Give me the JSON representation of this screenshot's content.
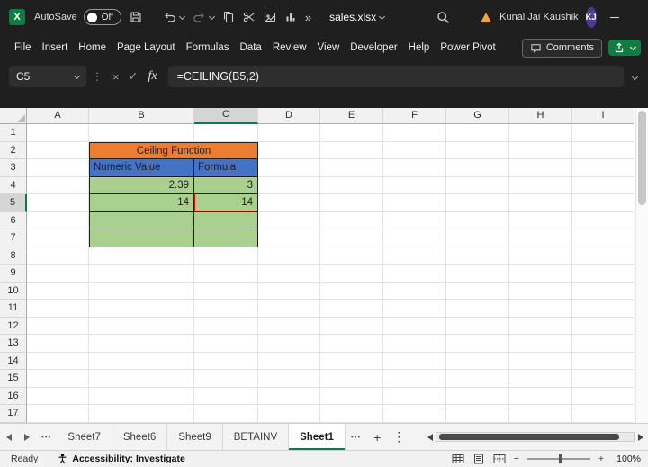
{
  "titlebar": {
    "autosave_label": "AutoSave",
    "autosave_state": "Off",
    "filename": "sales.xlsx",
    "user_name": "Kunal Jai Kaushik",
    "user_initials": "KJ"
  },
  "icons": {
    "excel_logo": "X",
    "more_chevrons": "»",
    "grip": "⋮",
    "cancel": "×",
    "check": "✓",
    "close": "×",
    "more_tabs": "•••",
    "plus": "+",
    "kebab": "⋮",
    "zoom_minus": "−",
    "zoom_plus": "+"
  },
  "menubar": {
    "items": [
      "File",
      "Insert",
      "Home",
      "Page Layout",
      "Formulas",
      "Data",
      "Review",
      "View",
      "Developer",
      "Help",
      "Power Pivot"
    ],
    "comments_label": "Comments"
  },
  "formula_bar": {
    "name_box": "C5",
    "fx_label": "fx",
    "formula": "=CEILING(B5,2)"
  },
  "grid": {
    "columns": [
      "A",
      "B",
      "C",
      "D",
      "E",
      "F",
      "G",
      "H",
      "I"
    ],
    "rows": [
      "1",
      "2",
      "3",
      "4",
      "5",
      "6",
      "7",
      "8",
      "9",
      "10",
      "11",
      "12",
      "13",
      "14",
      "15",
      "16",
      "17"
    ],
    "selected_cell": "C5",
    "selected_column": "C",
    "selected_row": "5",
    "cells": [
      {
        "ref": "B2",
        "colspan": 2,
        "text": "Ceiling Function",
        "kind": "title"
      },
      {
        "ref": "B3",
        "text": "Numeric Value",
        "kind": "header"
      },
      {
        "ref": "C3",
        "text": "Formula",
        "kind": "header"
      },
      {
        "ref": "B4",
        "text": "2.39",
        "kind": "value"
      },
      {
        "ref": "C4",
        "text": "3",
        "kind": "value"
      },
      {
        "ref": "B5",
        "text": "14",
        "kind": "value"
      },
      {
        "ref": "C5",
        "text": "14",
        "kind": "value",
        "highlight": "red-box"
      },
      {
        "ref": "B6",
        "text": "",
        "kind": "value"
      },
      {
        "ref": "C6",
        "text": "",
        "kind": "value"
      },
      {
        "ref": "B7",
        "text": "",
        "kind": "value"
      },
      {
        "ref": "C7",
        "text": "",
        "kind": "value"
      }
    ],
    "colors": {
      "title_bg": "#ED7D31",
      "header_bg": "#4472C4",
      "value_bg": "#A9D08E",
      "highlight_border": "#FF0000",
      "selection_green": "#107C41"
    }
  },
  "sheet_tabs": {
    "tabs": [
      "Sheet7",
      "Sheet6",
      "Sheet9",
      "BETAINV",
      "Sheet1"
    ],
    "active_tab": "Sheet1"
  },
  "status_bar": {
    "mode": "Ready",
    "accessibility": "Accessibility: Investigate",
    "zoom_level": "100%"
  }
}
